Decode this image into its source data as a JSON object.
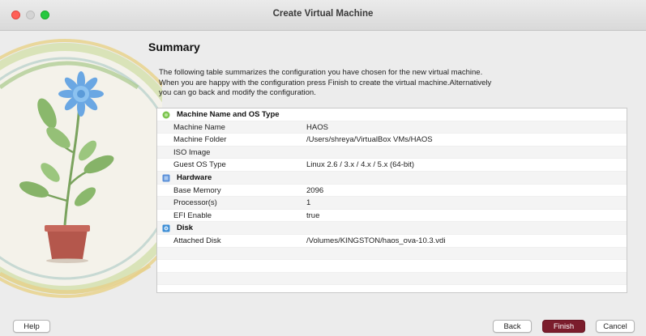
{
  "window": {
    "title": "Create Virtual Machine"
  },
  "page": {
    "heading": "Summary",
    "description": [
      "The following table summarizes the configuration you have chosen for the new virtual machine.",
      "When you are happy with the configuration press Finish to create the virtual machine.Alternatively",
      "you can go back and modify the configuration."
    ]
  },
  "summary": {
    "machine_section": {
      "title": "Machine Name and OS Type",
      "icon": "os-type-icon",
      "rows": [
        {
          "key": "Machine Name",
          "value": "HAOS"
        },
        {
          "key": "Machine Folder",
          "value": "/Users/shreya/VirtualBox VMs/HAOS"
        },
        {
          "key": "ISO Image",
          "value": ""
        },
        {
          "key": "Guest OS Type",
          "value": "Linux 2.6 / 3.x / 4.x / 5.x (64-bit)"
        }
      ]
    },
    "hardware_section": {
      "title": "Hardware",
      "icon": "hardware-chip-icon",
      "rows": [
        {
          "key": "Base Memory",
          "value": "2096"
        },
        {
          "key": "Processor(s)",
          "value": "1"
        },
        {
          "key": "EFI Enable",
          "value": "true"
        }
      ]
    },
    "disk_section": {
      "title": "Disk",
      "icon": "disk-icon",
      "rows": [
        {
          "key": "Attached Disk",
          "value": "/Volumes/KINGSTON/haos_ova-10.3.vdi"
        }
      ]
    }
  },
  "buttons": {
    "help": "Help",
    "back": "Back",
    "finish": "Finish",
    "cancel": "Cancel"
  },
  "colors": {
    "finish_button": "#7b1d2c",
    "close": "#ff5f57",
    "maximize": "#28c840"
  }
}
